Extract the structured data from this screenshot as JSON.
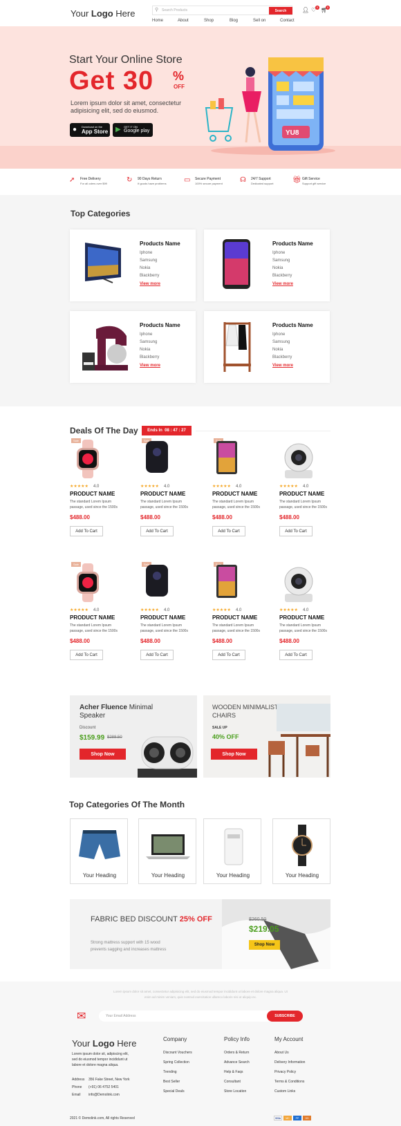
{
  "header": {
    "logo_prefix": "Your ",
    "logo_bold": "Logo",
    "logo_suffix": " Here",
    "search_placeholder": "Search Products",
    "search_button": "Search",
    "nav": [
      "Home",
      "About",
      "Shop",
      "Blog",
      "Sell on",
      "Contact"
    ],
    "wishlist_count": "0",
    "cart_count": "0"
  },
  "hero": {
    "line1": "Start Your Online Store",
    "line2": "Get 30",
    "percent": "%",
    "off": "OFF",
    "desc1": "Lorem ipsum dolor sit amet, consectetur",
    "desc2": "adipisicing elit, sed do eiusmod.",
    "appstore_small": "Download on the",
    "appstore": "App Store",
    "gplay_small": "GET IT ON",
    "gplay": "Google play",
    "phone_label": "YU8"
  },
  "features": [
    {
      "title": "Free Delivery",
      "sub": "For all oders over $99"
    },
    {
      "title": "90 Days Return",
      "sub": "If goods have problems"
    },
    {
      "title": "Secure Payment",
      "sub": "100% secure payment"
    },
    {
      "title": "24/7 Support",
      "sub": "Dedicated support"
    },
    {
      "title": "Gift Service",
      "sub": "Support gift service"
    }
  ],
  "top_categories": {
    "title": "Top Categories",
    "cards": [
      {
        "name": "Products Name",
        "items": [
          "Iphone",
          "Samsung",
          "Nokia",
          "Blackberry"
        ],
        "link": "View more"
      },
      {
        "name": "Products Name",
        "items": [
          "Iphone",
          "Samsung",
          "Nokia",
          "Blackberry"
        ],
        "link": "View more"
      },
      {
        "name": "Products Name",
        "items": [
          "Iphone",
          "Samsung",
          "Nokia",
          "Blackberry"
        ],
        "link": "View more"
      },
      {
        "name": "Products Name",
        "items": [
          "Iphone",
          "Samsung",
          "Nokia",
          "Blackberry"
        ],
        "link": "View more"
      }
    ]
  },
  "deals": {
    "title": "Deals Of The Day",
    "ends_label": "Ends In",
    "timer": "08 : 47 : 27",
    "tag": "Sale",
    "rating": "4.0",
    "product_name": "PRODUCT NAME",
    "desc1": "The standard Lorem Ipsum",
    "desc2": "passage, used since the 1500s",
    "price": "$488.00",
    "add_to_cart": "Add To Cart"
  },
  "promos": {
    "left_title_bold": "Acher Fluence",
    "left_title_light": " Minimal",
    "left_title_line2": "Speaker",
    "left_label": "Discount",
    "left_price": "$159.99",
    "left_old": "$288.50",
    "left_button": "Shop Now",
    "right_title1": "WOODEN MINIMALISTIC",
    "right_title2": "CHAIRS",
    "right_label": "SALE UP",
    "right_off": "40% OFF",
    "right_button": "Shop Now"
  },
  "month": {
    "title": "Top Categories Of The Month",
    "items": [
      "Your Heading",
      "Your Heading",
      "Your Heading",
      "Your Heading"
    ]
  },
  "fabric": {
    "title": "FABRIC BED DISCOUNT ",
    "off": "25% OFF",
    "desc1": "Strong mattress support with 15 wood",
    "desc2": "prevents sagging and increases mattress",
    "old": "$260.50",
    "price": "$219.05",
    "button": "Shop Now"
  },
  "newsletter": {
    "text1": "Lorem ipsum dolor sit amet, consectetur adipisicing elit, sed do eiusmod tempor incididunt ut labore et dolore magna aliqua. Ut",
    "text2": "enim ad minim veniam, quis nostrud exercitation ullamco laboris nisi ut aliquip ex.",
    "placeholder": "Your Email Address",
    "button": "SUBSCRIBE"
  },
  "footer": {
    "logo_prefix": "Your ",
    "logo_bold": "Logo",
    "logo_suffix": " Here",
    "about": [
      "Lorem ipsum dolor sit, adipiscing elit,",
      "sed do eiusmod tempor incididunt ut",
      "labore et dolore magna aliqua."
    ],
    "address_label": "Address",
    "address": "356 Fake Street, New York",
    "phone_label": "Phone",
    "phone": "(+91) 06 4752 5401",
    "email_label": "Email",
    "email": "info@Demolink.com",
    "cols": [
      {
        "title": "Company",
        "links": [
          "Discount Vouchers",
          "Spring Collection",
          "Trending",
          "Best Seller",
          "Special Deals"
        ]
      },
      {
        "title": "Policy Info",
        "links": [
          "Orders & Return",
          "Advance Search",
          "Help & Faqs",
          "Consultant",
          "Store Location"
        ]
      },
      {
        "title": "My Account",
        "links": [
          "About Us",
          "Delivery Information",
          "Privacy Policy",
          "Terms & Conditions",
          "Custom Links"
        ]
      }
    ],
    "copyright": "2021 © Demolink.com, All rights Reserved",
    "payments": [
      "VISA",
      "MC",
      "PP",
      "DS"
    ]
  }
}
